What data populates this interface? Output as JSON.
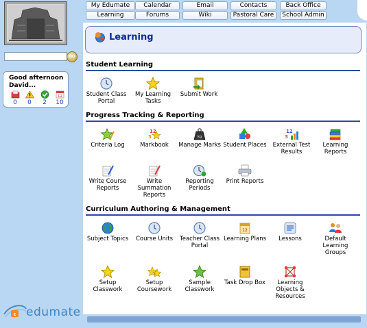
{
  "nav": {
    "row1": [
      "My Edumate",
      "Calendar",
      "Email",
      "Contacts",
      "Back Office"
    ],
    "row2": [
      "Learning",
      "Forums",
      "Wiki",
      "Pastoral Care",
      "School Admin"
    ]
  },
  "sidebar": {
    "search": {
      "value": "",
      "placeholder": "",
      "go_label": "GO"
    },
    "greeting": "Good afternoon David...",
    "counts": [
      {
        "icon": "inbox-icon",
        "count": "0"
      },
      {
        "icon": "warning-icon",
        "count": "0"
      },
      {
        "icon": "check-icon",
        "count": "2"
      },
      {
        "icon": "calendar-icon",
        "count": "10"
      }
    ],
    "logo_text": "edumate"
  },
  "page": {
    "title": "Learning"
  },
  "sections": [
    {
      "heading": "Student Learning",
      "items": [
        "Student Class Portal",
        "My Learning Tasks",
        "Submit Work"
      ]
    },
    {
      "heading": "Progress Tracking & Reporting",
      "items": [
        "Criteria Log",
        "Markbook",
        "Manage Marks",
        "Student Places",
        "External Test Results",
        "Learning Reports",
        "Write Course Reports",
        "Write Summation Reports",
        "Reporting Periods",
        "Print Reports"
      ]
    },
    {
      "heading": "Curriculum Authoring & Management",
      "items": [
        "Subject Topics",
        "Course Units",
        "Teacher Class Portal",
        "Learning Plans",
        "Lessons",
        "Default Learning Groups",
        "Setup Classwork",
        "Setup Coursework",
        "Sample Classwork",
        "Task Drop Box",
        "Learning Objects & Resources"
      ]
    }
  ],
  "colors": {
    "accent": "#274aa3",
    "background": "#b9d6f2",
    "title_box": "#e7ecfb"
  }
}
